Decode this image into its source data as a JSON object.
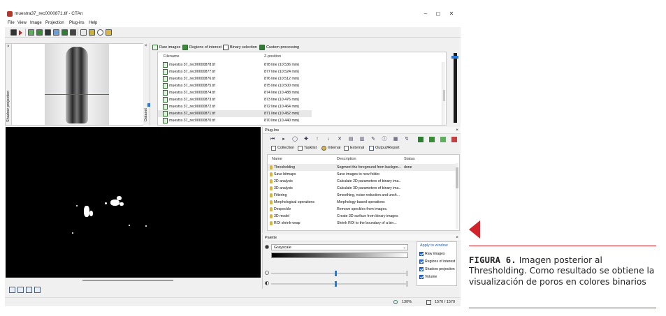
{
  "window": {
    "title": "muestra37_rec0000871.tif - CTAn",
    "minimize": "–",
    "maximize": "◻",
    "close": "✕"
  },
  "menu": [
    "File",
    "View",
    "Image",
    "Projection",
    "Plug-ins",
    "Help"
  ],
  "shadow_panel": {
    "label": "Shadow projection",
    "close": "×"
  },
  "dataset_panel": {
    "label": "Dataset",
    "tabs": [
      "Raw images",
      "Regions of interest",
      "Binary selection",
      "Custom processing"
    ],
    "columns": [
      "Filename",
      "Z-position"
    ],
    "files": [
      {
        "name": "muestra 37_rec00000878.tif",
        "z": "878 line (10.536 mm)"
      },
      {
        "name": "muestra 37_rec00000877.tif",
        "z": "877 line (10.524 mm)"
      },
      {
        "name": "muestra 37_rec00000876.tif",
        "z": "876 line (10.512 mm)"
      },
      {
        "name": "muestra 37_rec00000875.tif",
        "z": "875 line (10.500 mm)"
      },
      {
        "name": "muestra 37_rec00000874.tif",
        "z": "874 line (10.488 mm)"
      },
      {
        "name": "muestra 37_rec00000873.tif",
        "z": "873 line (10.476 mm)"
      },
      {
        "name": "muestra 37_rec00000872.tif",
        "z": "872 line (10.464 mm)"
      },
      {
        "name": "muestra 37_rec00000871.tif",
        "z": "871 line (10.452 mm)"
      },
      {
        "name": "muestra 37_rec00000870.tif",
        "z": "870 line (10.440 mm)"
      }
    ]
  },
  "plugins_panel": {
    "title": "Plug-Ins",
    "close": "×",
    "tabs": [
      "Collection",
      "Tasklist",
      "Internal",
      "External",
      "Output/Report"
    ],
    "columns": [
      "Name",
      "Description",
      "Status"
    ],
    "rows": [
      {
        "name": "Thresholding",
        "desc": "Segment the foreground from backgro...",
        "status": "done"
      },
      {
        "name": "Save bitmaps",
        "desc": "Save images to new folder.",
        "status": ""
      },
      {
        "name": "2D analysis",
        "desc": "Calculate 2D parameters of binary ima...",
        "status": ""
      },
      {
        "name": "3D analysis",
        "desc": "Calculate 3D parameters of binary ima...",
        "status": ""
      },
      {
        "name": "Filtering",
        "desc": "Smoothing, noise reduction and unsh...",
        "status": ""
      },
      {
        "name": "Morphological operations",
        "desc": "Morphology-based operations",
        "status": ""
      },
      {
        "name": "Despeckle",
        "desc": "Remove speckles from images.",
        "status": ""
      },
      {
        "name": "3D model",
        "desc": "Create 3D surface from binary images",
        "status": ""
      },
      {
        "name": "ROI shrink-wrap",
        "desc": "Shrink ROI to the boundary of a bin...",
        "status": ""
      }
    ]
  },
  "palette_panel": {
    "title": "Palette",
    "close": "×",
    "palette": "Grayscale",
    "apply_title": "Apply to window",
    "apply_options": [
      "Raw images",
      "Regions of interest",
      "Shadow projection",
      "Volume"
    ]
  },
  "status": {
    "zoom": "130%",
    "slice": "1570 / 1570"
  },
  "caption": {
    "figure": "FIGURA 6.",
    "text": " Imagen posterior al Thresholding. Como resultado se obtiene la visualización de poros en colores binarios"
  },
  "colors": {
    "accent": "#d2232a",
    "selection": "#2a6fd6"
  }
}
